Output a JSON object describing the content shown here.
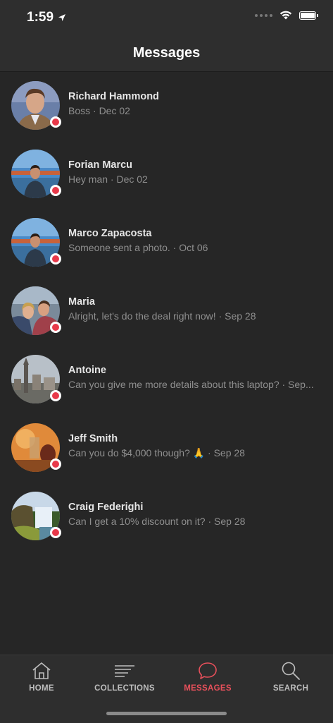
{
  "status_bar": {
    "time": "1:59"
  },
  "header": {
    "title": "Messages"
  },
  "conversations": [
    {
      "name": "Richard Hammond",
      "preview": "Boss · Dec 02"
    },
    {
      "name": "Forian Marcu",
      "preview": "Hey man · Dec 02"
    },
    {
      "name": "Marco Zapacosta",
      "preview": "Someone sent a photo. · Oct 06"
    },
    {
      "name": "Maria",
      "preview": "Alright, let's do the deal right now! · Sep 28"
    },
    {
      "name": "Antoine",
      "preview": "Can you give me more details about this laptop? · Sep..."
    },
    {
      "name": "Jeff Smith",
      "preview": "Can you do $4,000 though? 🙏 · Sep 28"
    },
    {
      "name": "Craig Federighi",
      "preview": "Can I get a 10% discount on it? · Sep 28"
    }
  ],
  "tabs": [
    {
      "label": "HOME",
      "icon": "home-icon"
    },
    {
      "label": "COLLECTIONS",
      "icon": "collections-icon"
    },
    {
      "label": "MESSAGES",
      "icon": "chat-bubble-icon",
      "active": true
    },
    {
      "label": "SEARCH",
      "icon": "search-icon"
    }
  ],
  "colors": {
    "accent": "#e8505b",
    "unread_dot": "#e8394a",
    "background": "#262626",
    "bar": "#2e2e2e"
  }
}
